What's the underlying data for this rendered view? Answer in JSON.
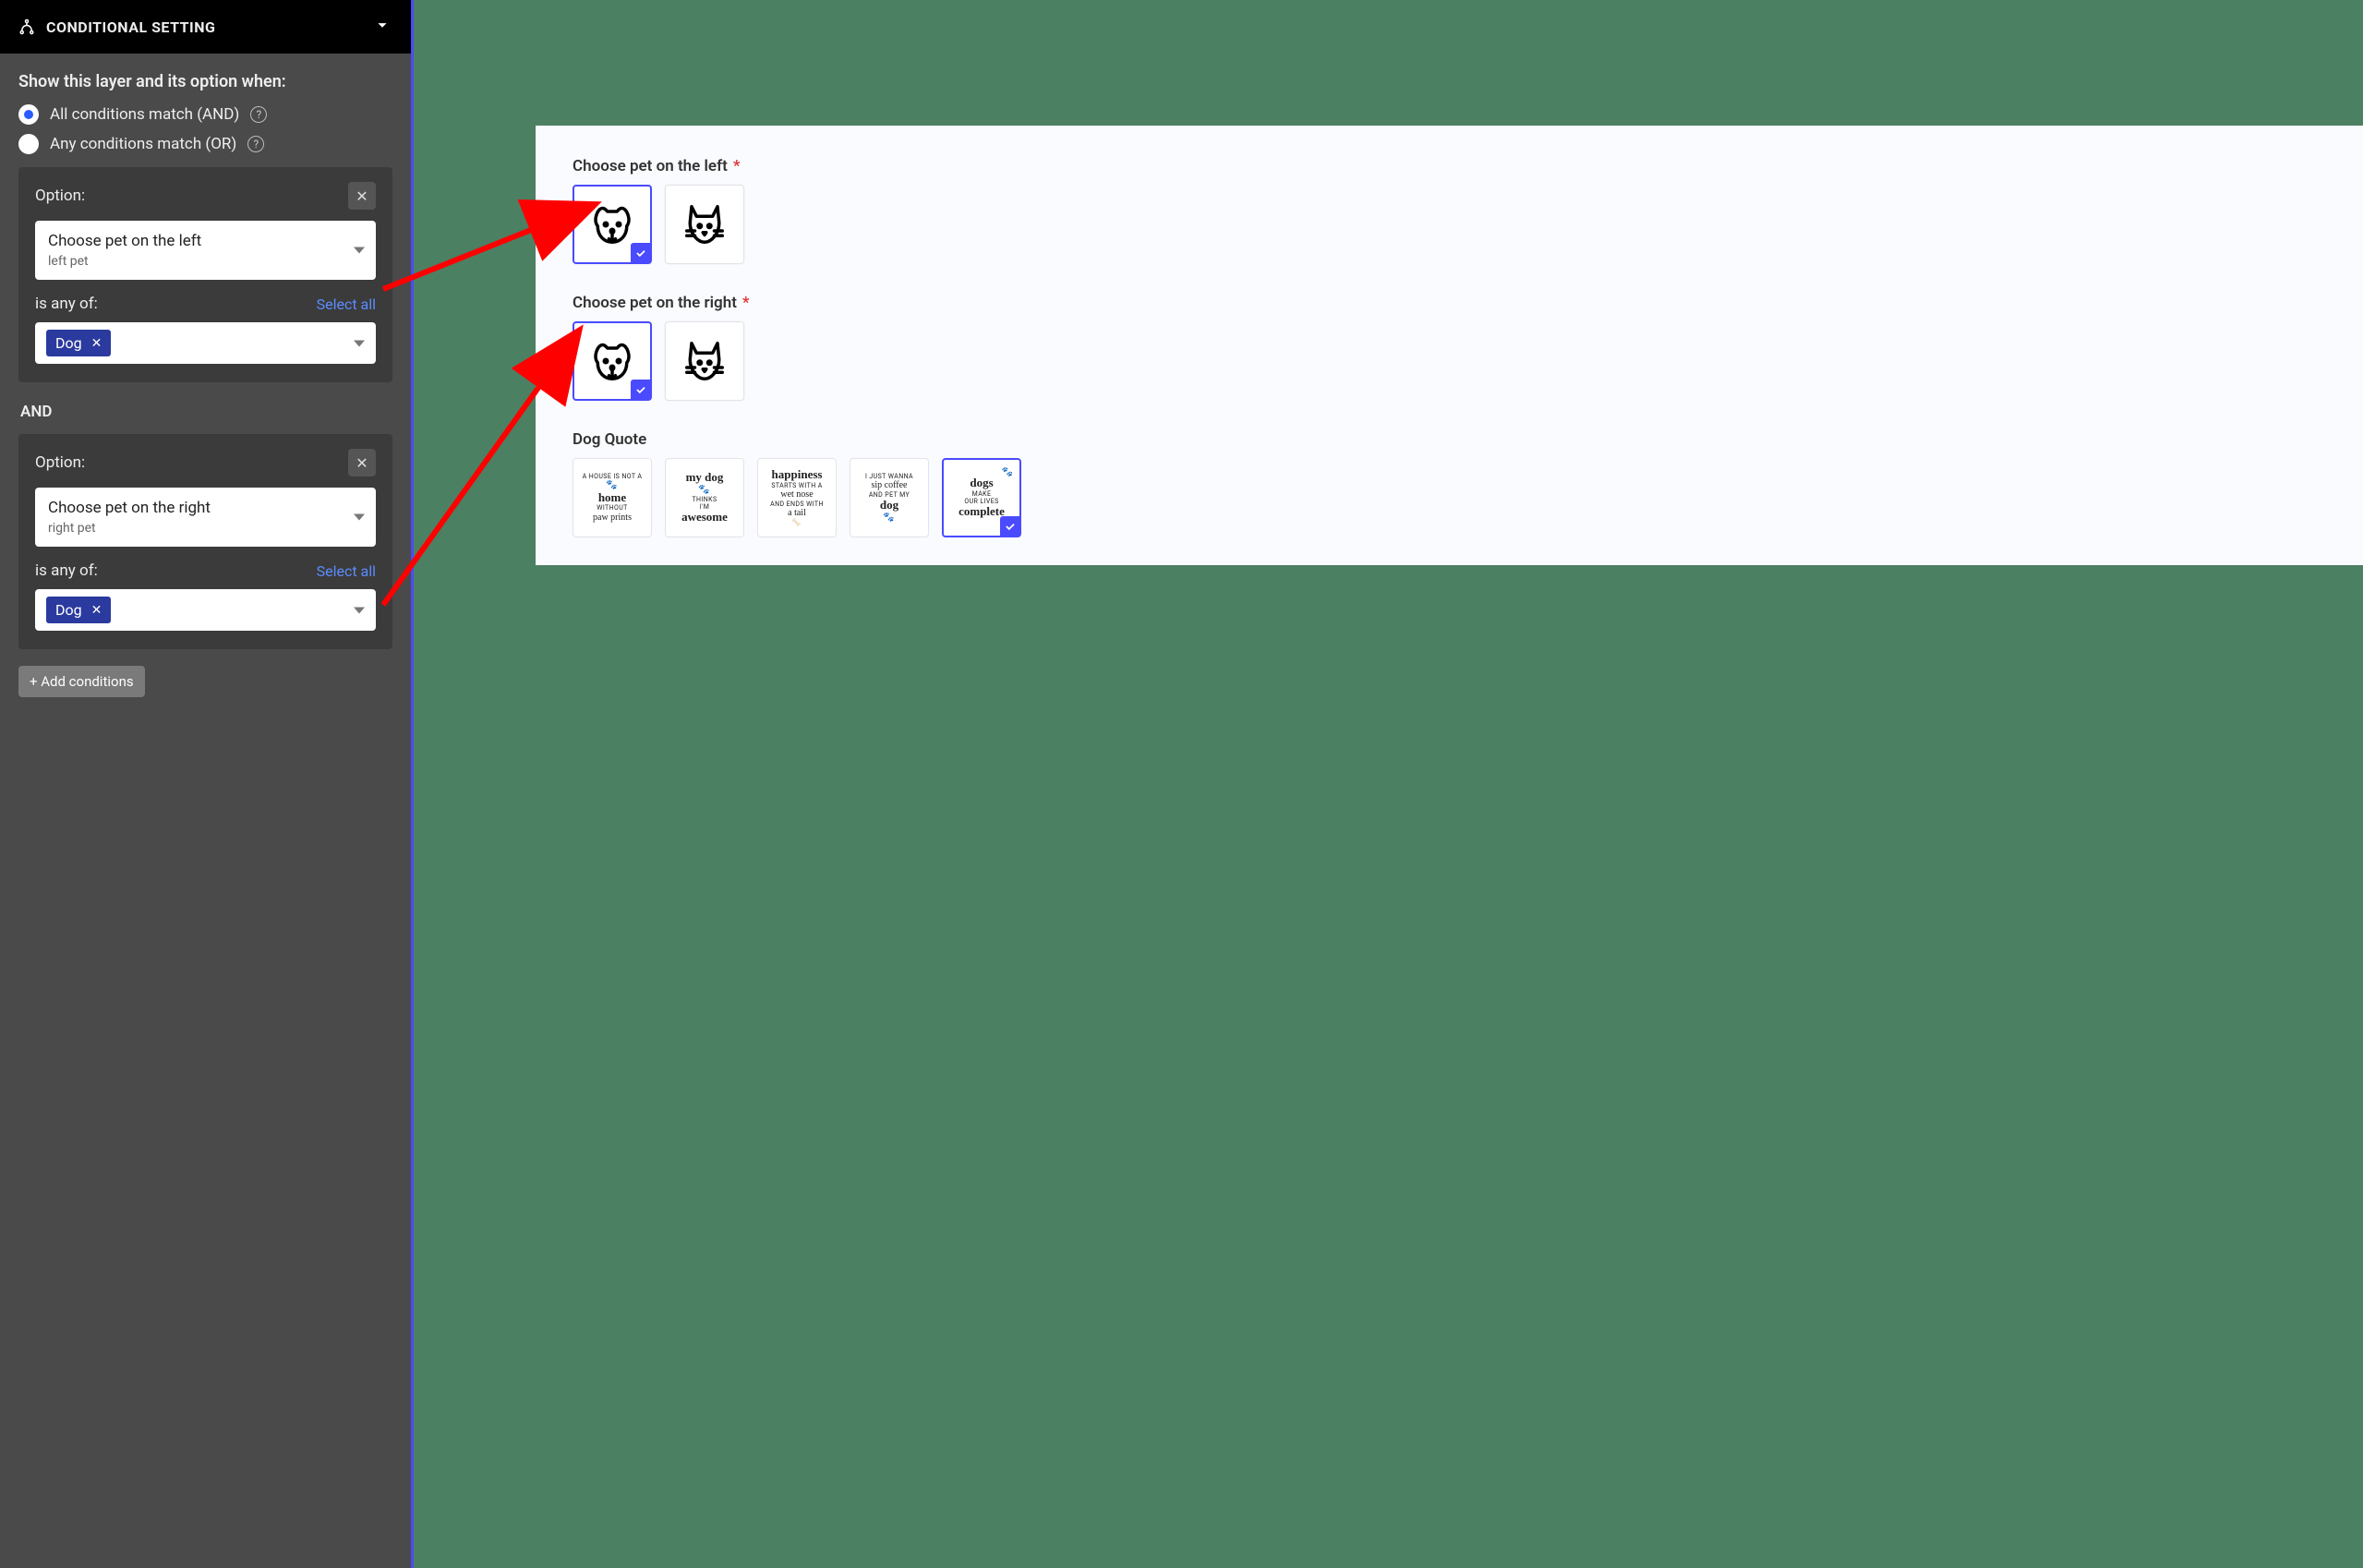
{
  "sidebar": {
    "title": "CONDITIONAL SETTING",
    "instruction": "Show this layer and its option when:",
    "radios": {
      "and": "All conditions match (AND)",
      "or": "Any conditions match (OR)"
    },
    "option_label": "Option:",
    "isany_label": "is any of:",
    "selectall": "Select all",
    "and_sep": "AND",
    "add_label": "+ Add conditions",
    "cond1": {
      "main": "Choose pet on the left",
      "sub": "left pet",
      "tag": "Dog"
    },
    "cond2": {
      "main": "Choose pet on the right",
      "sub": "right pet",
      "tag": "Dog"
    }
  },
  "preview": {
    "leftLabel": "Choose pet on the left",
    "rightLabel": "Choose pet on the right",
    "quoteLabel": "Dog Quote",
    "quotes": {
      "q1a": "A HOUSE IS NOT A",
      "q1b": "home",
      "q1c": "WITHOUT",
      "q1d": "paw prints",
      "q2a": "my dog",
      "q2b": "THINKS",
      "q2c": "I'M",
      "q2d": "awesome",
      "q3a": "happiness",
      "q3b": "STARTS WITH A",
      "q3c": "wet nose",
      "q3d": "AND ENDS WITH",
      "q3e": "a tail",
      "q4a": "I JUST WANNA",
      "q4b": "sip coffee",
      "q4c": "AND PET MY",
      "q4d": "dog",
      "q5a": "dogs",
      "q5b": "MAKE",
      "q5c": "OUR LIVES",
      "q5d": "complete"
    }
  }
}
